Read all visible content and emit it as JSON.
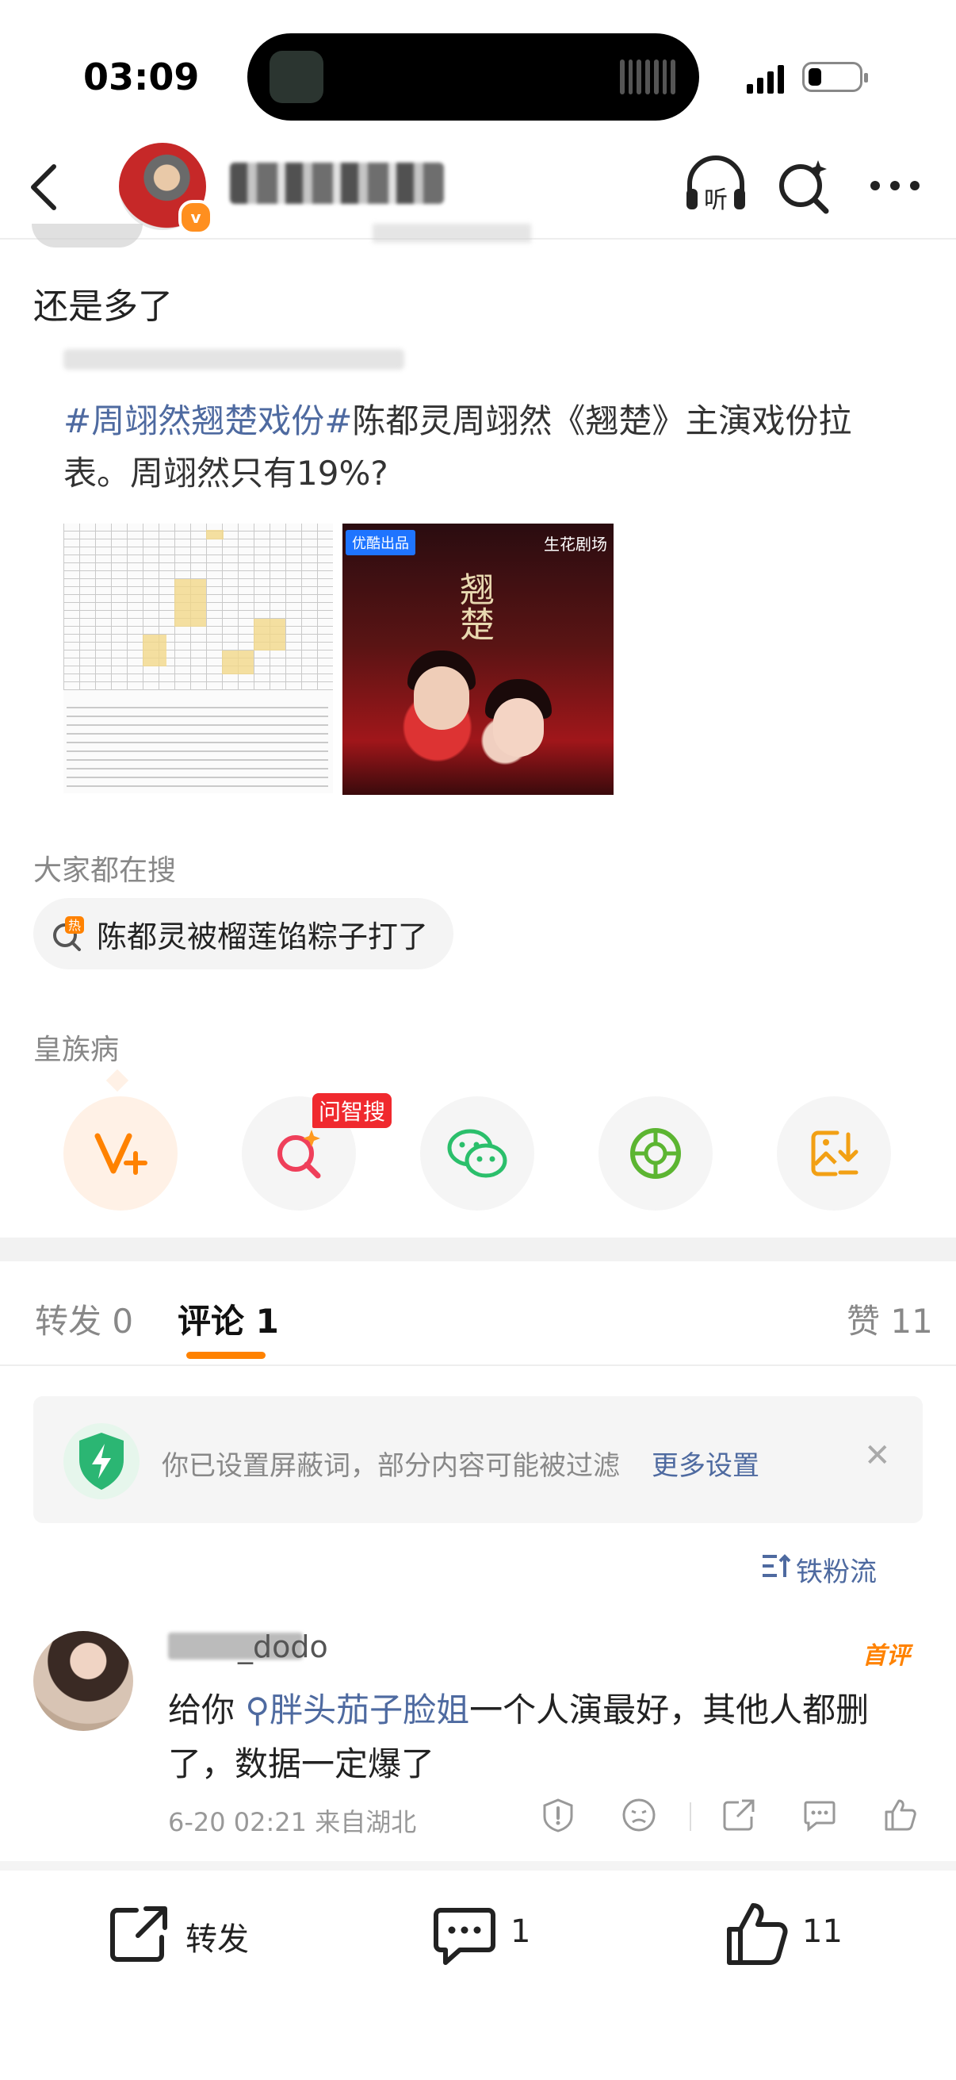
{
  "status_bar": {
    "time": "03:09"
  },
  "post": {
    "text": "还是多了",
    "quote": {
      "tag": "#周翊然翘楚戏份#",
      "body": "陈都灵周翊然《翘楚》主演戏份拉表。周翊然只有19%?",
      "poster": {
        "badge_left": "优酷出品",
        "badge_right": "生花剧场",
        "title": "翘楚"
      }
    }
  },
  "everyone_searching": {
    "label": "大家都在搜",
    "hot_badge": "热",
    "query": "陈都灵被榴莲馅粽子打了"
  },
  "topic": "皇族病",
  "share_row": {
    "ai_badge": "问智搜"
  },
  "tabs": [
    {
      "label": "转发 0"
    },
    {
      "label": "评论 1"
    },
    {
      "label": "赞 11"
    }
  ],
  "filter_notice": {
    "text": "你已设置屏蔽词，部分内容可能被过滤",
    "link": "更多设置"
  },
  "sort_label": "铁粉流",
  "comment": {
    "username": "_dodo",
    "first_badge": "首评",
    "prefix": "给你",
    "link": "胖头茄子脸姐",
    "suffix": "一个人演最好，其他人都删了，数据一定爆了",
    "meta": "6-20 02:21 来自湖北"
  },
  "bottom_bar": {
    "repost": "转发",
    "comment_count": "1",
    "like_count": "11"
  },
  "colors": {
    "accent": "#ff8200",
    "link": "#4e6aa0",
    "hot_red": "#f0292e"
  }
}
